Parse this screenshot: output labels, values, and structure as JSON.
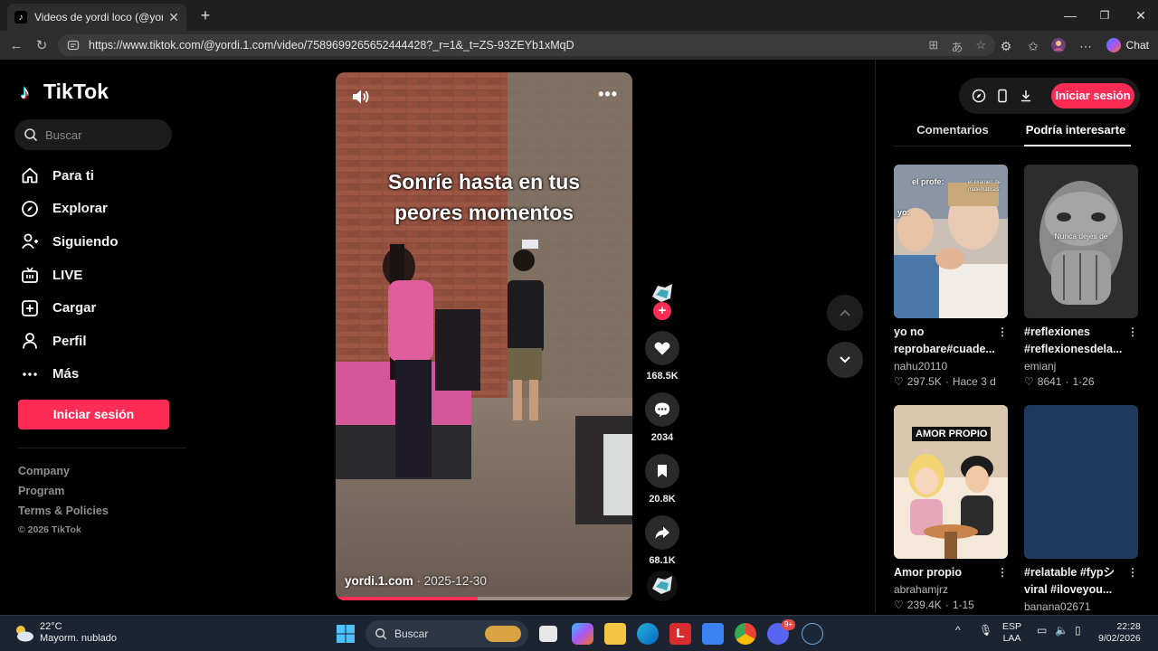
{
  "browser": {
    "tab_title": "Videos de yordi loco (@yordi.1.com",
    "tab_close": "✕",
    "new_tab": "+",
    "url": "https://www.tiktok.com/@yordi.1.com/video/7589699265652444428?_r=1&_t=ZS-93ZEYb1xMqD",
    "chat_label": "Chat"
  },
  "sidebar": {
    "logo_text": "TikTok",
    "search_placeholder": "Buscar",
    "nav": [
      {
        "label": "Para ti",
        "icon": "home-icon"
      },
      {
        "label": "Explorar",
        "icon": "compass-icon"
      },
      {
        "label": "Siguiendo",
        "icon": "following-icon"
      },
      {
        "label": "LIVE",
        "icon": "live-icon"
      },
      {
        "label": "Cargar",
        "icon": "upload-icon"
      },
      {
        "label": "Perfil",
        "icon": "profile-icon"
      },
      {
        "label": "Más",
        "icon": "more-icon"
      }
    ],
    "login_label": "Iniciar sesión",
    "footer": {
      "company": "Company",
      "program": "Program",
      "terms": "Terms & Policies",
      "copyright": "© 2026 TikTok"
    }
  },
  "video": {
    "caption_line1": "Sonríe hasta en tus",
    "caption_line2": "peores momentos",
    "author": "yordi.1.com",
    "date_sep": " · ",
    "date": "2025-12-30",
    "progress": 0.48
  },
  "actions": {
    "follow_plus": "+",
    "likes": "168.5K",
    "comments": "2034",
    "saves": "20.8K",
    "shares": "68.1K"
  },
  "right_panel": {
    "login_label": "Iniciar sesión",
    "tab_comments": "Comentarios",
    "tab_suggested": "Podría interesarte",
    "cards": [
      {
        "title": "yo no reprobare#cuade...",
        "user": "nahu20110",
        "likes": "297.5K",
        "sep": "·",
        "extra": "Hace 3 d",
        "thumb_text_1": "el profe:",
        "thumb_text_2": "yo:",
        "thumb_text_3": "el examen de matemáticas:"
      },
      {
        "title": "#reflexiones #reflexionesdela...",
        "user": "emianj",
        "likes": "8641",
        "sep": "·",
        "extra": "1-26",
        "thumb_text_1": "Nunca dejes de"
      },
      {
        "title": "Amor propio",
        "user": "abrahamjrz",
        "likes": "239.4K",
        "sep": "·",
        "extra": "1-15",
        "thumb_text_1": "AMOR PROPIO"
      },
      {
        "title": "#relatable #fypシ viral #iloveyou...",
        "user": "banana02671",
        "likes": "",
        "sep": "",
        "extra": ""
      }
    ]
  },
  "taskbar": {
    "temp": "22°C",
    "weather": "Mayorm. nublado",
    "search": "Buscar",
    "lang1": "ESP",
    "lang2": "LAA",
    "time": "22:28",
    "date": "9/02/2026",
    "badge": "9+"
  }
}
